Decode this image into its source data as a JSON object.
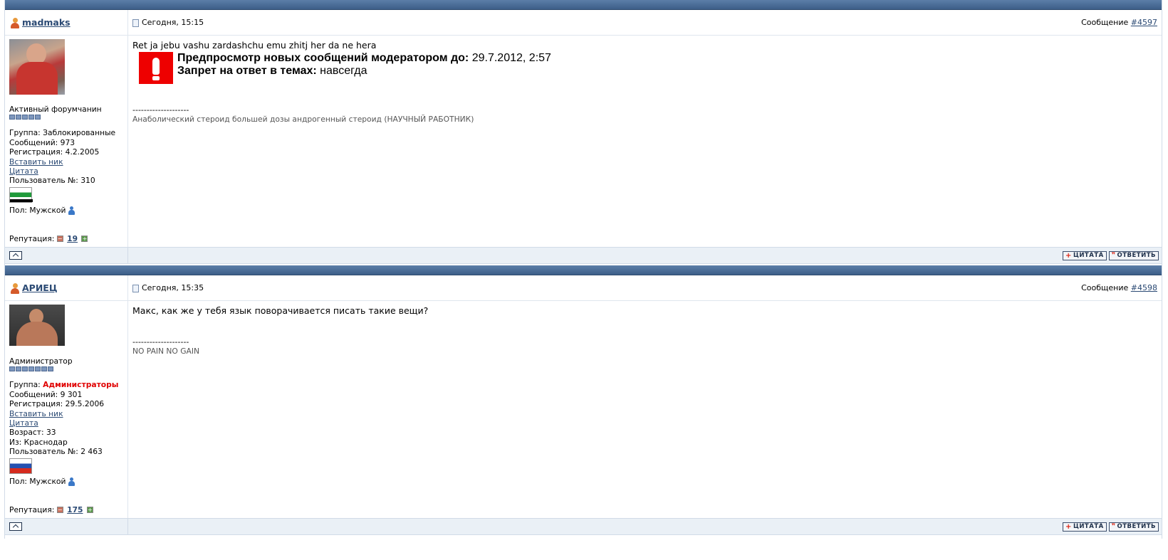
{
  "posts": [
    {
      "username": "madmaks",
      "date": "Сегодня, 15:15",
      "message_label": "Сообщение",
      "message_num": "#4597",
      "rank": "Активный форумчанин",
      "pips": 5,
      "group_label": "Группа:",
      "group": "Заблокированные",
      "posts_count": "Сообщений: 973",
      "registered": "Регистрация: 4.2.2005",
      "insert_nick": "Вставить ник",
      "quote_link": "Цитата",
      "user_number": "Пользователь №: 310",
      "gender": "Пол: Мужской",
      "rep_label": "Репутация:",
      "rep_value": "19",
      "body": "Ret ja jebu vashu zardashchu emu zhitj her da ne hera",
      "warning": {
        "line1_bold": "Предпросмотр новых сообщений модератором до:",
        "line1_value": "29.7.2012, 2:57",
        "line2_bold": "Запрет на ответ в темах:",
        "line2_value": "навсегда"
      },
      "sig_line": "--------------------",
      "signature": "Анаболический стероид большей дозы андрогенный стероид (НАУЧНЫЙ РАБОТНИК)"
    },
    {
      "username": "АРИЕЦ",
      "date": "Сегодня, 15:35",
      "message_label": "Сообщение",
      "message_num": "#4598",
      "rank": "Администратор",
      "pips": 7,
      "group_label": "Группа:",
      "group": "Администраторы",
      "posts_count": "Сообщений: 9 301",
      "registered": "Регистрация: 29.5.2006",
      "insert_nick": "Вставить ник",
      "quote_link": "Цитата",
      "age": "Возраст: 33",
      "from": "Из: Краснодар",
      "user_number": "Пользователь №: 2 463",
      "gender": "Пол: Мужской",
      "rep_label": "Репутация:",
      "rep_value": "175",
      "body": "Макс, как же у тебя язык поворачивается писать такие вещи?",
      "sig_line": "--------------------",
      "signature": "NO PAIN NO GAIN"
    }
  ],
  "buttons": {
    "quote": "ЦИТАТА",
    "reply": "ОТВЕТИТЬ"
  },
  "colors": {
    "header_bar": "#4a6d99",
    "link": "#2b4a74",
    "admin_group": "#e00000",
    "footer_bg": "#eaf0f6"
  }
}
